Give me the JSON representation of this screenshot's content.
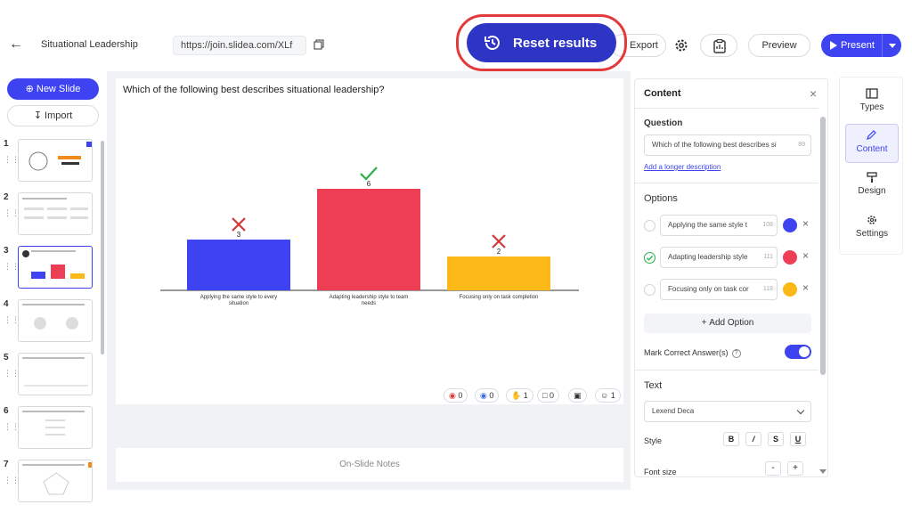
{
  "topbar": {
    "doc_title": "Situational Leadership",
    "url": "https://join.slidea.com/XLf",
    "reset_label": "Reset results",
    "export_label": "Export",
    "preview_label": "Preview",
    "present_label": "Present"
  },
  "left": {
    "new_slide_label": "New Slide",
    "import_label": "Import",
    "thumbnails": [
      {
        "num": "1"
      },
      {
        "num": "2"
      },
      {
        "num": "3"
      },
      {
        "num": "4"
      },
      {
        "num": "5"
      },
      {
        "num": "6"
      },
      {
        "num": "7"
      }
    ],
    "active_index": 3
  },
  "slide": {
    "question": "Which of the following best describes situational leadership?",
    "status": {
      "s1": "0",
      "s2": "0",
      "s3": "1",
      "s4": "0",
      "s6": "1"
    },
    "notes_label": "On-Slide Notes"
  },
  "chart_data": {
    "type": "bar",
    "categories": [
      "Applying the same style to every situation",
      "Adapting leadership style to team needs",
      "Focusing only on task completion"
    ],
    "category_lines": [
      [
        "Applying the same style to every",
        "situation"
      ],
      [
        "Adapting leadership style to team",
        "needs"
      ],
      [
        "Focusing only on task completion"
      ]
    ],
    "values": [
      3,
      6,
      2
    ],
    "colors": [
      "#3d43f0",
      "#ee3e55",
      "#fbb817"
    ],
    "correct": [
      false,
      true,
      false
    ],
    "ylim": [
      0,
      6
    ],
    "grid": false
  },
  "panel": {
    "title": "Content",
    "question_label": "Question",
    "question_value": "Which of the following best describes si",
    "question_count": "89",
    "add_description": "Add a longer description",
    "options_label": "Options",
    "options": [
      {
        "text": "Applying the same style t",
        "count": "108",
        "color": "#3d43f0",
        "correct": false
      },
      {
        "text": "Adapting leadership style",
        "count": "111",
        "color": "#ee3e55",
        "correct": true
      },
      {
        "text": "Focusing only on task cor",
        "count": "118",
        "color": "#fbb817",
        "correct": false
      }
    ],
    "add_option": "Add Option",
    "mark_correct": "Mark Correct Answer(s)",
    "text_label": "Text",
    "font_value": "Lexend Deca",
    "style_label": "Style",
    "style_bold": "B",
    "style_italic": "/",
    "style_strike": "S",
    "style_underline": "U",
    "font_size_label": "Font size",
    "size_minus": "-",
    "size_plus": "+"
  },
  "tabs": {
    "types": "Types",
    "content": "Content",
    "design": "Design",
    "settings": "Settings"
  }
}
